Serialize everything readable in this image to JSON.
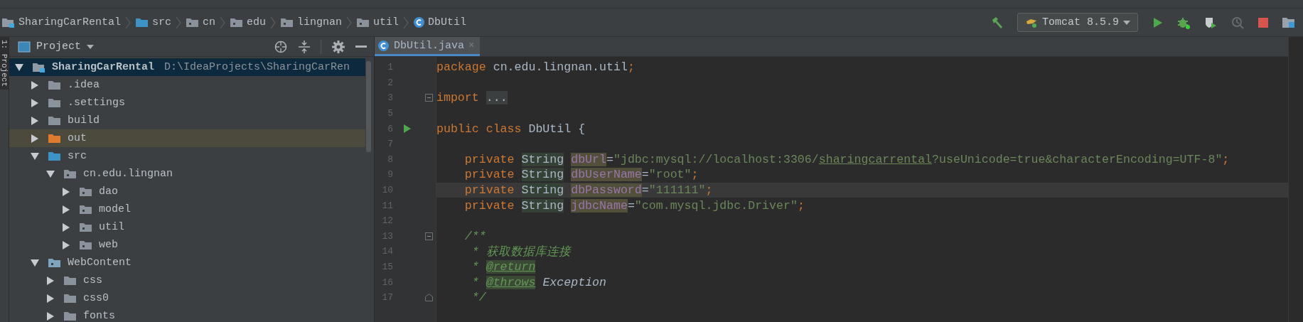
{
  "breadcrumbs": [
    {
      "label": "SharingCarRental",
      "kind": "module"
    },
    {
      "label": "src",
      "kind": "source"
    },
    {
      "label": "cn",
      "kind": "package"
    },
    {
      "label": "edu",
      "kind": "package"
    },
    {
      "label": "lingnan",
      "kind": "package"
    },
    {
      "label": "util",
      "kind": "package"
    },
    {
      "label": "DbUtil",
      "kind": "class"
    }
  ],
  "toolbar": {
    "run_config": "Tomcat 8.5.9",
    "buttons": [
      {
        "kind": "build",
        "disabled": false
      },
      {
        "kind": "run",
        "disabled": false
      },
      {
        "kind": "debug",
        "disabled": false
      },
      {
        "kind": "coverage",
        "disabled": false
      },
      {
        "kind": "profile",
        "disabled": true
      },
      {
        "kind": "stop",
        "disabled": false
      },
      {
        "kind": "structure",
        "disabled": false
      }
    ]
  },
  "tool_strip": {
    "label": "1: Project"
  },
  "project": {
    "title": "Project",
    "tree": [
      {
        "label": "SharingCarRental",
        "path": "D:\\IdeaProjects\\SharingCarRen",
        "kind": "module",
        "expanded": true,
        "selected": true,
        "children": [
          {
            "label": ".idea",
            "kind": "folder",
            "expanded": false,
            "selected": false
          },
          {
            "label": ".settings",
            "kind": "folder",
            "expanded": false,
            "selected": false
          },
          {
            "label": "build",
            "kind": "folder",
            "expanded": false,
            "selected": false
          },
          {
            "label": "out",
            "kind": "excluded",
            "expanded": false,
            "selected": false
          },
          {
            "label": "src",
            "kind": "source",
            "expanded": true,
            "selected": false,
            "children": [
              {
                "label": "cn.edu.lingnan",
                "kind": "package",
                "expanded": true,
                "selected": false,
                "children": [
                  {
                    "label": "dao",
                    "kind": "package",
                    "expanded": false,
                    "selected": false
                  },
                  {
                    "label": "model",
                    "kind": "package",
                    "expanded": false,
                    "selected": false
                  },
                  {
                    "label": "util",
                    "kind": "package",
                    "expanded": false,
                    "selected": false
                  },
                  {
                    "label": "web",
                    "kind": "package",
                    "expanded": false,
                    "selected": false
                  }
                ]
              }
            ]
          },
          {
            "label": "WebContent",
            "kind": "web",
            "expanded": true,
            "selected": false,
            "children": [
              {
                "label": "css",
                "kind": "folder",
                "expanded": false,
                "selected": false
              },
              {
                "label": "css0",
                "kind": "folder",
                "expanded": false,
                "selected": false
              },
              {
                "label": "fonts",
                "kind": "folder",
                "expanded": false,
                "selected": false
              }
            ]
          }
        ]
      }
    ]
  },
  "editor": {
    "tabs": [
      {
        "label": "DbUtil.java",
        "close": "×",
        "selected": true
      }
    ],
    "lines": [
      {
        "number": "1",
        "current": false,
        "kind": "top",
        "tokens": [
          {
            "text": "package ",
            "kind": "keyword"
          },
          {
            "text": "cn.edu.lingnan.util",
            "kind": "plain"
          },
          {
            "text": ";",
            "kind": "keyword"
          }
        ]
      },
      {
        "number": "2",
        "current": false,
        "kind": "top"
      },
      {
        "number": "3",
        "current": false,
        "kind": "top",
        "marker": {
          "kind": "fold"
        },
        "tokens": [
          {
            "text": "import ",
            "kind": "keyword"
          },
          {
            "text": "...",
            "kind": "folded"
          }
        ]
      },
      {
        "number": "5",
        "current": false,
        "kind": "top"
      },
      {
        "number": "6",
        "current": false,
        "kind": "top",
        "marker": {
          "kind": "run"
        },
        "tokens": [
          {
            "text": "public class ",
            "kind": "keyword"
          },
          {
            "text": "DbUtil {",
            "kind": "plain"
          }
        ]
      },
      {
        "number": "7",
        "current": false,
        "kind": "top"
      },
      {
        "number": "8",
        "current": false,
        "kind": "member",
        "tokens": [
          {
            "text": "private ",
            "kind": "keyword"
          },
          {
            "text": "String",
            "kind": "type-usage"
          },
          {
            "text": "dbUrl",
            "kind": "field-usage"
          },
          {
            "text": "=",
            "kind": "plain"
          },
          {
            "text": "\"jdbc:mysql://localhost:3306/",
            "kind": "string"
          },
          {
            "text": "sharingcarrental",
            "kind": "string-link"
          },
          {
            "text": "?useUnicode=true&characterEncoding=UTF-8\"",
            "kind": "string"
          },
          {
            "text": ";",
            "kind": "keyword"
          }
        ]
      },
      {
        "number": "9",
        "current": false,
        "kind": "member",
        "tokens": [
          {
            "text": "private ",
            "kind": "keyword"
          },
          {
            "text": "String",
            "kind": "type-usage"
          },
          {
            "text": "dbUserName",
            "kind": "field-usage"
          },
          {
            "text": "=",
            "kind": "plain"
          },
          {
            "text": "\"root\"",
            "kind": "string"
          },
          {
            "text": ";",
            "kind": "keyword"
          }
        ]
      },
      {
        "number": "10",
        "current": true,
        "kind": "member",
        "tokens": [
          {
            "text": "private ",
            "kind": "keyword"
          },
          {
            "text": "String",
            "kind": "type-usage"
          },
          {
            "text": "dbPassword",
            "kind": "field-usage"
          },
          {
            "text": "=",
            "kind": "plain"
          },
          {
            "text": "\"111111\"",
            "kind": "string"
          },
          {
            "text": ";",
            "kind": "keyword"
          }
        ]
      },
      {
        "number": "11",
        "current": false,
        "kind": "member",
        "tokens": [
          {
            "text": "private ",
            "kind": "keyword"
          },
          {
            "text": "String",
            "kind": "type-usage"
          },
          {
            "text": "jdbcName",
            "kind": "field-usage"
          },
          {
            "text": "=",
            "kind": "plain"
          },
          {
            "text": "\"com.mysql.jdbc.Driver\"",
            "kind": "string"
          },
          {
            "text": ";",
            "kind": "keyword"
          }
        ]
      },
      {
        "number": "12",
        "current": false,
        "kind": "top"
      },
      {
        "number": "13",
        "current": false,
        "kind": "member",
        "marker": {
          "kind": "fold"
        },
        "tokens": [
          {
            "text": "/**",
            "kind": "doc"
          }
        ]
      },
      {
        "number": "14",
        "current": false,
        "kind": "doc-body",
        "tokens": [
          {
            "text": "* 获取数据库连接",
            "kind": "doc"
          }
        ]
      },
      {
        "number": "15",
        "current": false,
        "kind": "doc-body",
        "tokens": [
          {
            "text": "* ",
            "kind": "doc"
          },
          {
            "text": "@return",
            "kind": "doc-tag"
          }
        ]
      },
      {
        "number": "16",
        "current": false,
        "kind": "doc-body",
        "tokens": [
          {
            "text": "* ",
            "kind": "doc"
          },
          {
            "text": "@throws",
            "kind": "doc-tag"
          },
          {
            "text": " Exception",
            "kind": "doc-ref"
          }
        ]
      },
      {
        "number": "17",
        "current": false,
        "kind": "doc-body",
        "marker": {
          "kind": "fold-end"
        },
        "tokens": [
          {
            "text": "*/",
            "kind": "doc"
          }
        ]
      }
    ]
  }
}
